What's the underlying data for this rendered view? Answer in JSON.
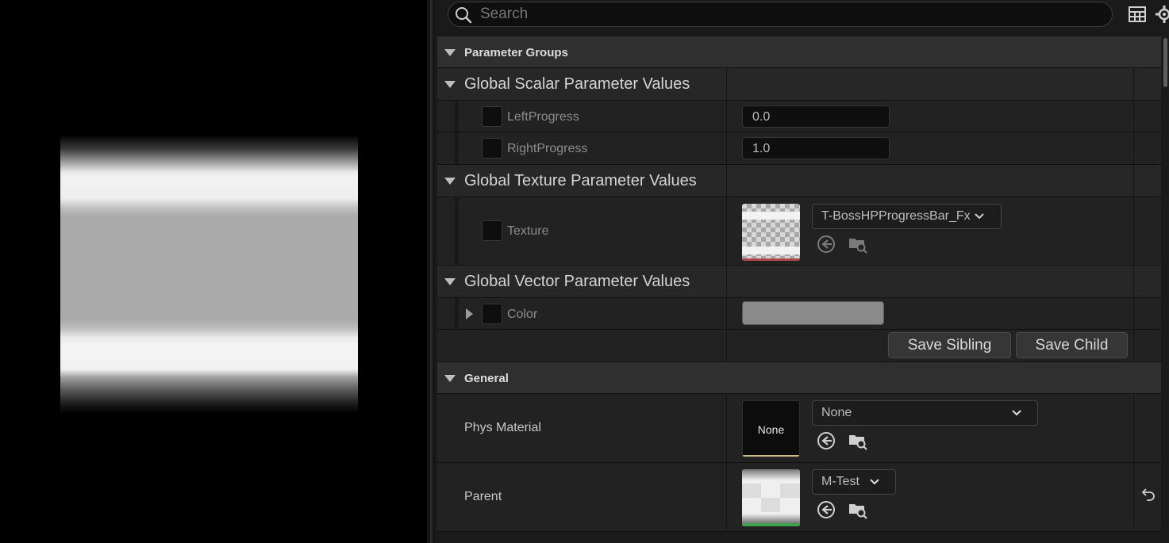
{
  "search": {
    "placeholder": "Search"
  },
  "categories": {
    "parameter_groups": "Parameter Groups",
    "general": "General"
  },
  "groups": {
    "scalar": "Global Scalar Parameter Values",
    "texture": "Global Texture Parameter Values",
    "vector": "Global Vector Parameter Values"
  },
  "scalar_params": [
    {
      "label": "LeftProgress",
      "value": "0.0"
    },
    {
      "label": "RightProgress",
      "value": "1.0"
    }
  ],
  "texture_param": {
    "label": "Texture",
    "asset": "T-BossHPProgressBar_Fx"
  },
  "vector_param": {
    "label": "Color",
    "swatch_color": "#8a8a8a"
  },
  "buttons": {
    "save_sibling": "Save Sibling",
    "save_child": "Save Child"
  },
  "general": {
    "phys_material": {
      "label": "Phys Material",
      "thumb_text": "None",
      "value": "None"
    },
    "parent": {
      "label": "Parent",
      "value": "M-Test"
    }
  },
  "icons": {
    "search": "search-icon",
    "table": "table-view-icon",
    "settings": "settings-gear-icon",
    "use_selected": "use-selected-asset-icon",
    "browse": "browse-to-asset-icon",
    "reset": "reset-to-default-icon",
    "dropdown": "chevron-down-icon"
  }
}
